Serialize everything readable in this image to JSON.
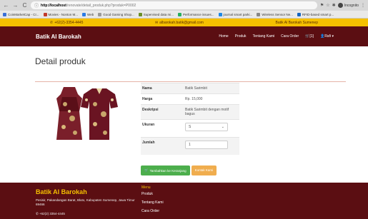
{
  "browser": {
    "back": "←",
    "forward": "→",
    "reload": "C",
    "info_icon": "ⓘ",
    "url_host": "http://localhost",
    "url_path": "/renovate/detail_produk.php?produk=P0002",
    "incognito_label": "Incognito",
    "bookmarks": [
      {
        "label": "CoinMarketCap - Cr...",
        "color": "#3b6fd6"
      },
      {
        "label": "Movies - Nonton M...",
        "color": "#c0392b"
      },
      {
        "label": "Web",
        "color": "#2c7be5"
      },
      {
        "label": "Good Gaming Shop...",
        "color": "#999999"
      },
      {
        "label": "Supervised data mi...",
        "color": "#6a8f2a"
      },
      {
        "label": "Performance issues...",
        "color": "#27ae60"
      },
      {
        "label": "journal smart parki...",
        "color": "#1e88e5"
      },
      {
        "label": "Wireless Sensor Ne...",
        "color": "#888888"
      },
      {
        "label": "RFID-based smart p...",
        "color": "#1565c0"
      }
    ]
  },
  "topbar": {
    "phone": "+62(2)-3354-4445",
    "email": "albarokah.batik@gmail.com",
    "location": "Batik Al Barokah Sumenep"
  },
  "navbar": {
    "brand": "Batik Al Barokah",
    "items": [
      "Home",
      "Produk",
      "Tentang Kami",
      "Cara Order"
    ],
    "cart": "[1]",
    "user": "Rafi"
  },
  "main": {
    "title": "Detail produk",
    "fields": {
      "name_label": "Nama",
      "name_value": "Batik Sarimbit",
      "price_label": "Harga",
      "price_value": "Rp. 15,000",
      "desc_label": "Deskripsi",
      "desc_value": "Batik Sarimbit dengan motif bagus",
      "size_label": "Ukuran",
      "size_value": "S",
      "qty_label": "Jumlah",
      "qty_value": "1"
    },
    "add_to_cart": "Tambahkan ke Keranjang",
    "contact": "Kontak Kami"
  },
  "footer": {
    "brand": "Batik Al Barokah",
    "address": "Pesisir, Pakandangan Barat, Bluto, Kabupaten Sumenep, Jawa Timur 69466",
    "phone": "+62(2) 3354-4445",
    "menu_title": "Menu",
    "menu": [
      "Produk",
      "Tentang Kami",
      "Cara Order"
    ]
  },
  "colors": {
    "maroon": "#5b0e12",
    "gold": "#f5c000",
    "green": "#4cae4c",
    "orange": "#f0ad4e"
  }
}
